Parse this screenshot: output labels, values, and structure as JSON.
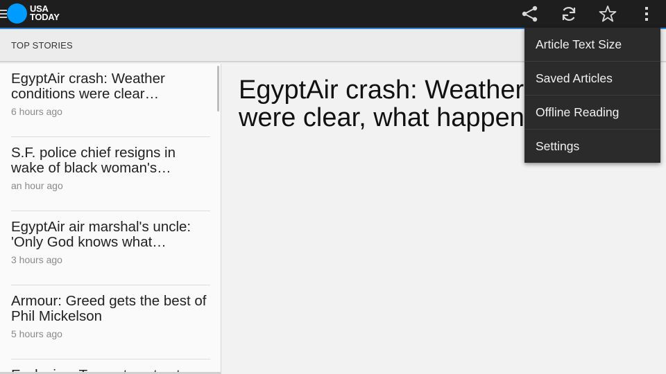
{
  "app": {
    "logo_line1": "USA",
    "logo_line2": "TODAY"
  },
  "actionbar": {
    "icons": [
      "menu-icon",
      "share-icon",
      "refresh-icon",
      "star-icon",
      "more-vert-icon"
    ]
  },
  "section": {
    "title": "TOP STORIES"
  },
  "stories": [
    {
      "title": "EgyptAir crash: Weather conditions were clear…",
      "time": "6 hours ago"
    },
    {
      "title": "S.F. police chief resigns in wake of black woman's…",
      "time": "an hour ago"
    },
    {
      "title": "EgyptAir air marshal's uncle: 'Only God knows what…",
      "time": "3 hours ago"
    },
    {
      "title": "Armour: Greed gets the best of Phil Mickelson",
      "time": "5 hours ago"
    },
    {
      "title": "Exclusive: Trump tweets at",
      "time": ""
    }
  ],
  "article": {
    "headline": "EgyptAir crash: Weather conditions were clear, what happened is not"
  },
  "menu": {
    "items": [
      "Article Text Size",
      "Saved Articles",
      "Offline Reading",
      "Settings"
    ]
  },
  "colors": {
    "actionbar": "#1e1e1e",
    "accent_line": "#2f7fd6",
    "logo_circle": "#009bff",
    "menu_bg": "#2b2b2b"
  }
}
